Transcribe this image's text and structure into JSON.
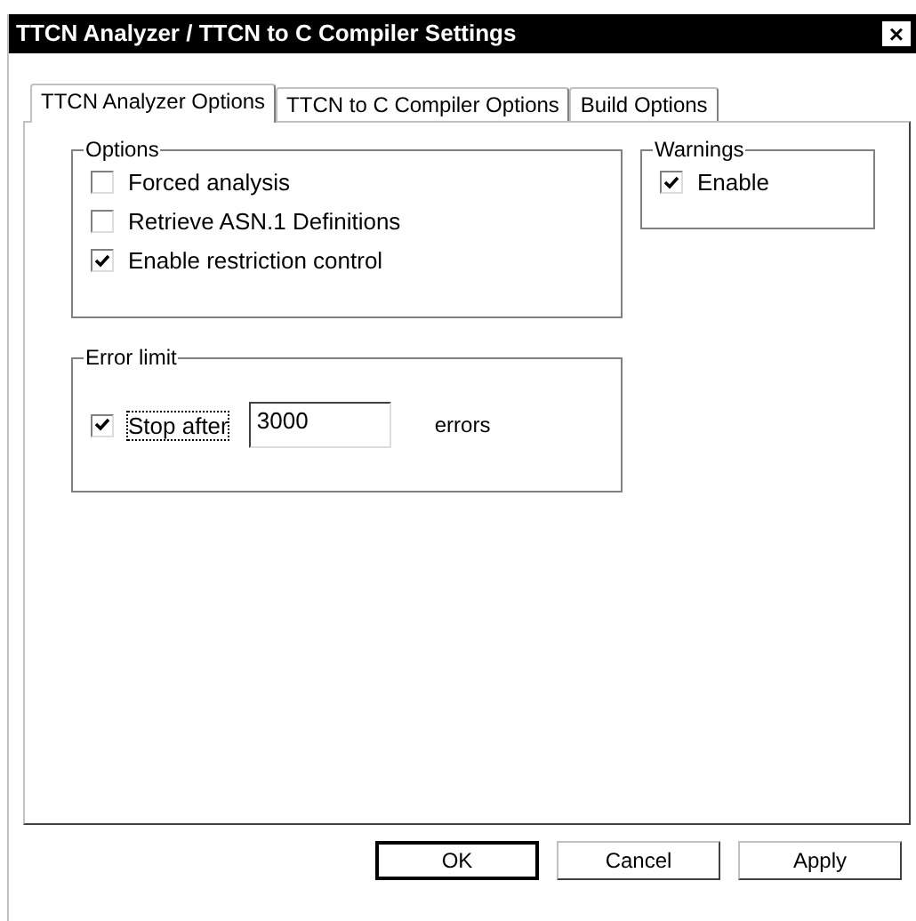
{
  "window": {
    "title": "TTCN Analyzer / TTCN to C Compiler Settings",
    "close": "×"
  },
  "tabs": [
    {
      "label": "TTCN Analyzer Options",
      "selected": true
    },
    {
      "label": "TTCN to C Compiler Options",
      "selected": false
    },
    {
      "label": "Build Options",
      "selected": false
    }
  ],
  "options": {
    "title": "Options",
    "items": [
      {
        "label": "Forced analysis",
        "checked": false
      },
      {
        "label": "Retrieve ASN.1 Definitions",
        "checked": false
      },
      {
        "label": "Enable restriction control",
        "checked": true
      }
    ]
  },
  "warnings": {
    "title": "Warnings",
    "items": [
      {
        "label": "Enable",
        "checked": true
      }
    ]
  },
  "error_limit": {
    "title": "Error limit",
    "stop_after": {
      "label": "Stop after",
      "checked": true,
      "focused": true
    },
    "value": "3000",
    "unit": "errors"
  },
  "buttons": [
    {
      "label": "OK",
      "default": true
    },
    {
      "label": "Cancel",
      "default": false
    },
    {
      "label": "Apply",
      "default": false
    }
  ]
}
